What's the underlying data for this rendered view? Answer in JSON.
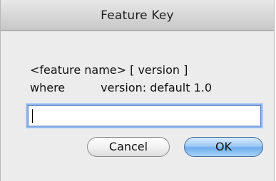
{
  "dialog": {
    "title": "Feature Key",
    "message_line1": "<feature name> [ version ]",
    "message_line2_left": "where",
    "message_line2_right": "version: default 1.0",
    "input_value": "",
    "cancel_label": "Cancel",
    "ok_label": "OK"
  },
  "colors": {
    "window_background": "#ececec",
    "focus_ring": "#8fb4e8",
    "default_button": "#6fadeb"
  }
}
